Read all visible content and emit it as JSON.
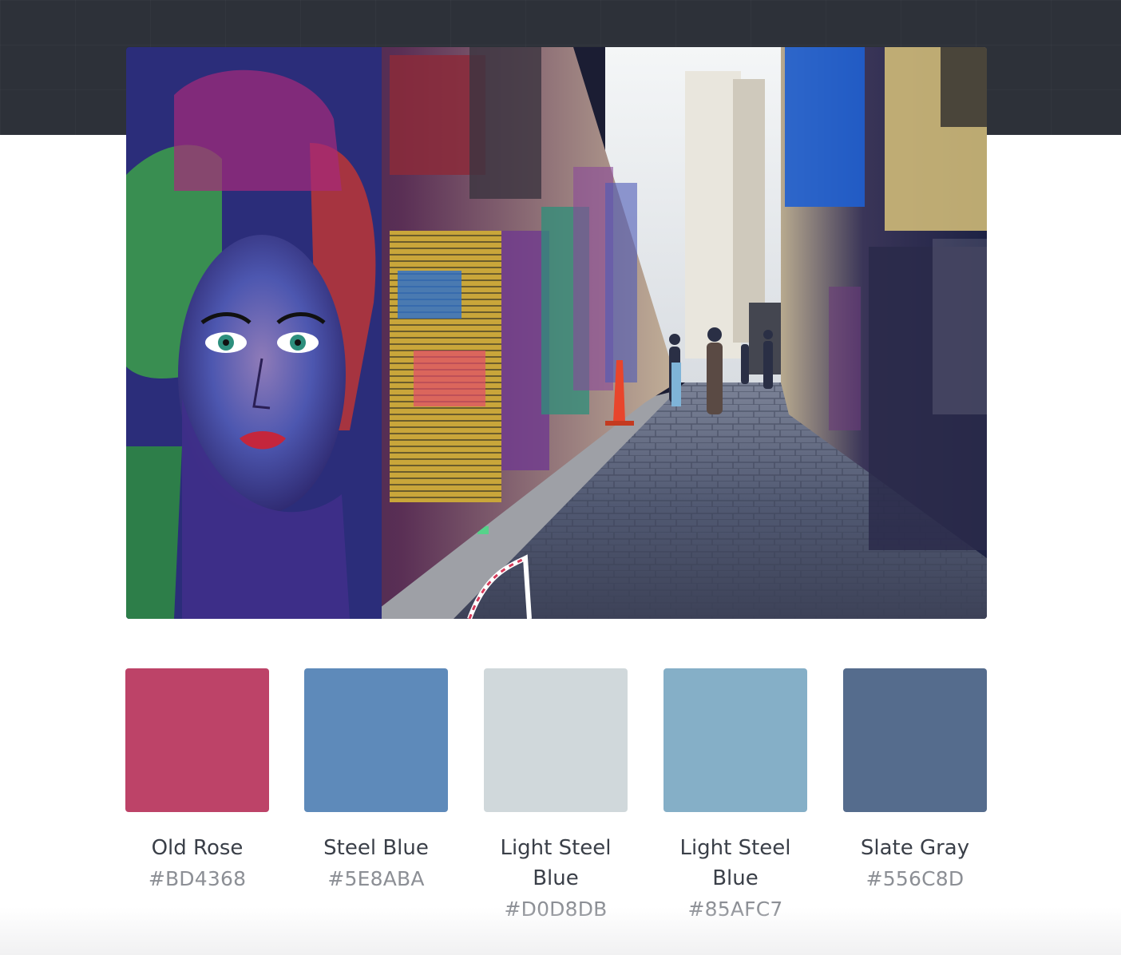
{
  "colors": {
    "header_band": "#2d3139",
    "name_text": "#3a3f48",
    "hex_text": "#8c8f95"
  },
  "photo": {
    "subject": "graffiti-covered laneway with mural of a woman's face and cobblestone street"
  },
  "palette": [
    {
      "name": "Old Rose",
      "hex": "#BD4368",
      "swatch": "#BD4368"
    },
    {
      "name": "Steel Blue",
      "hex": "#5E8ABA",
      "swatch": "#5E8ABA"
    },
    {
      "name": "Light Steel Blue",
      "hex": "#D0D8DB",
      "swatch": "#D0D8DB"
    },
    {
      "name": "Light Steel Blue",
      "hex": "#85AFC7",
      "swatch": "#85AFC7"
    },
    {
      "name": "Slate Gray",
      "hex": "#556C8D",
      "swatch": "#556C8D"
    }
  ]
}
